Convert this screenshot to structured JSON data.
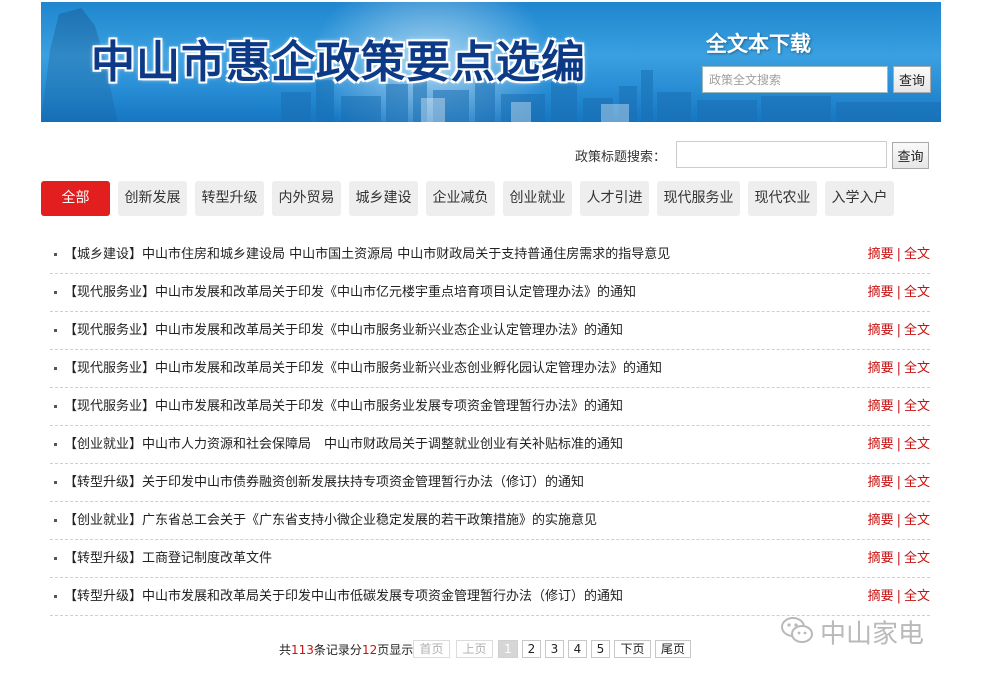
{
  "banner": {
    "title": "中山市惠企政策要点选编",
    "download_label": "全文本下载",
    "search_placeholder": "政策全文搜索",
    "search_button": "查询"
  },
  "title_search": {
    "label": "政策标题搜索：",
    "value": "",
    "button": "查询"
  },
  "tabs": [
    {
      "label": "全部",
      "active": true
    },
    {
      "label": "创新发展",
      "active": false
    },
    {
      "label": "转型升级",
      "active": false
    },
    {
      "label": "内外贸易",
      "active": false
    },
    {
      "label": "城乡建设",
      "active": false
    },
    {
      "label": "企业减负",
      "active": false
    },
    {
      "label": "创业就业",
      "active": false
    },
    {
      "label": "人才引进",
      "active": false
    },
    {
      "label": "现代服务业",
      "active": false
    },
    {
      "label": "现代农业",
      "active": false
    },
    {
      "label": "入学入户",
      "active": false
    }
  ],
  "list": {
    "summary_label": "摘要",
    "separator": "|",
    "fulltext_label": "全文",
    "items": [
      {
        "title": "【城乡建设】中山市住房和城乡建设局 中山市国土资源局 中山市财政局关于支持普通住房需求的指导意见"
      },
      {
        "title": "【现代服务业】中山市发展和改革局关于印发《中山市亿元楼宇重点培育项目认定管理办法》的通知"
      },
      {
        "title": "【现代服务业】中山市发展和改革局关于印发《中山市服务业新兴业态企业认定管理办法》的通知"
      },
      {
        "title": "【现代服务业】中山市发展和改革局关于印发《中山市服务业新兴业态创业孵化园认定管理办法》的通知"
      },
      {
        "title": "【现代服务业】中山市发展和改革局关于印发《中山市服务业发展专项资金管理暂行办法》的通知"
      },
      {
        "title": "【创业就业】中山市人力资源和社会保障局　中山市财政局关于调整就业创业有关补贴标准的通知"
      },
      {
        "title": "【转型升级】关于印发中山市债券融资创新发展扶持专项资金管理暂行办法（修订）的通知"
      },
      {
        "title": "【创业就业】广东省总工会关于《广东省支持小微企业稳定发展的若干政策措施》的实施意见"
      },
      {
        "title": "【转型升级】工商登记制度改革文件"
      },
      {
        "title": "【转型升级】中山市发展和改革局关于印发中山市低碳发展专项资金管理暂行办法（修订）的通知"
      }
    ]
  },
  "pagination": {
    "prefix": "共",
    "total": "113",
    "mid": "条记录分",
    "pages": "12",
    "suffix": "页显示",
    "first": "首页",
    "prev": "上页",
    "page_numbers": [
      "1",
      "2",
      "3",
      "4",
      "5"
    ],
    "current": "1",
    "next": "下页",
    "last": "尾页"
  },
  "watermark": {
    "text": "中山家电",
    "icon": "wechat-icon"
  },
  "colors": {
    "accent_red": "#e21e1e",
    "link_red": "#c81212",
    "banner_blue": "#2a8fd6",
    "title_navy": "#0d3a86"
  }
}
